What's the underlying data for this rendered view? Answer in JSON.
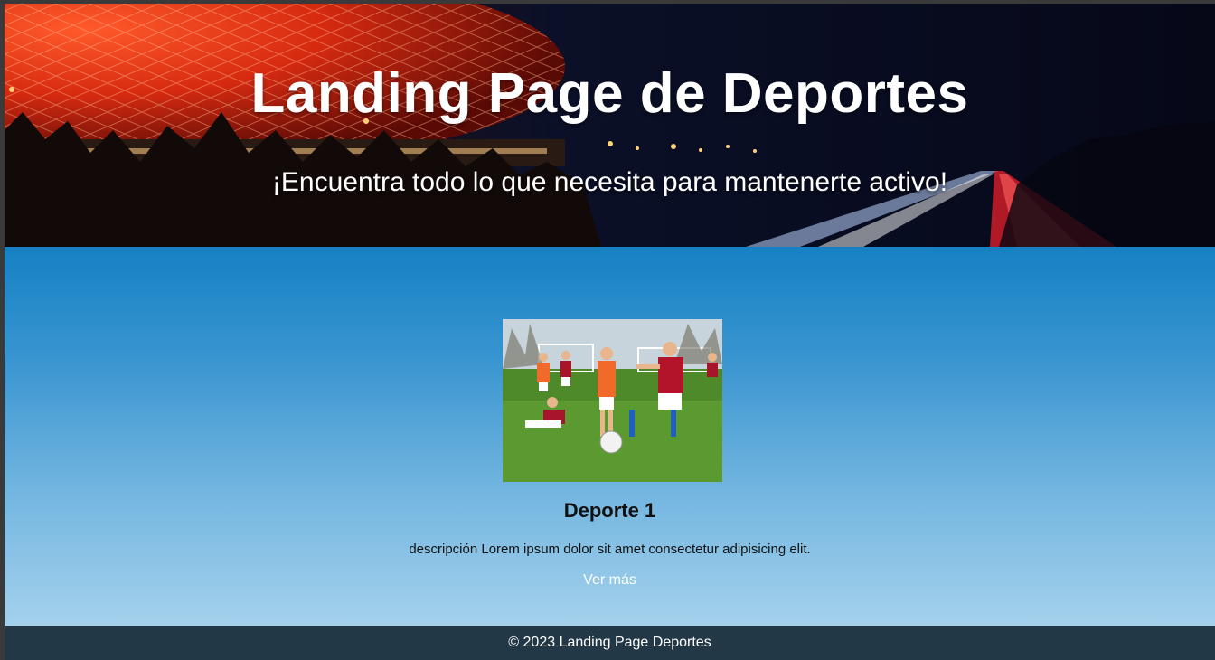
{
  "hero": {
    "title": "Landing Page de Deportes",
    "subtitle": "¡Encuentra todo lo que necesita para mantenerte activo!"
  },
  "card": {
    "image_alt": "soccer-kids-photo",
    "title": "Deporte 1",
    "description": "descripción Lorem ipsum dolor sit amet consectetur adipisicing elit.",
    "link_label": "Ver más"
  },
  "footer": {
    "text": "© 2023 Landing Page Deportes"
  },
  "colors": {
    "main_gradient_top": "#1581c4",
    "main_gradient_bottom": "#a4d1ec",
    "footer_bg": "#233846",
    "stadium_red": "#e8331a"
  }
}
